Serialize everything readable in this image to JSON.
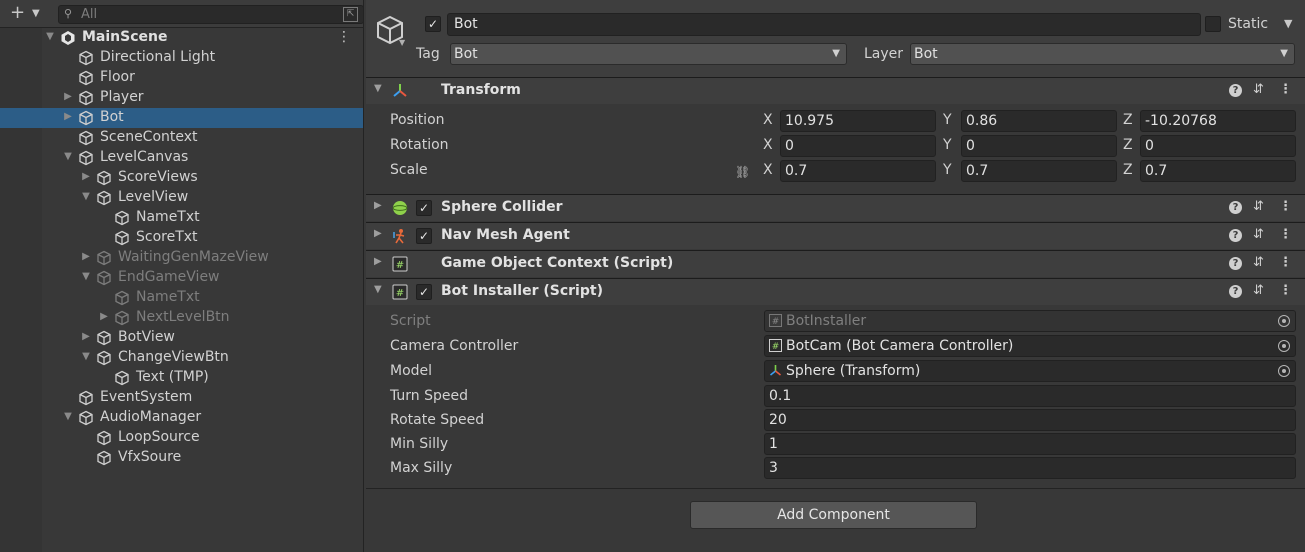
{
  "hierarchy": {
    "search_placeholder": "All",
    "rows": [
      {
        "label": "MainScene",
        "depth": 0,
        "arrow": "down",
        "type": "scene"
      },
      {
        "label": "Directional Light",
        "depth": 1,
        "arrow": ""
      },
      {
        "label": "Floor",
        "depth": 1,
        "arrow": ""
      },
      {
        "label": "Player",
        "depth": 1,
        "arrow": "right"
      },
      {
        "label": "Bot",
        "depth": 1,
        "arrow": "right",
        "selected": true
      },
      {
        "label": "SceneContext",
        "depth": 1,
        "arrow": ""
      },
      {
        "label": "LevelCanvas",
        "depth": 1,
        "arrow": "down"
      },
      {
        "label": "ScoreViews",
        "depth": 2,
        "arrow": "right"
      },
      {
        "label": "LevelView",
        "depth": 2,
        "arrow": "down"
      },
      {
        "label": "NameTxt",
        "depth": 3,
        "arrow": ""
      },
      {
        "label": "ScoreTxt",
        "depth": 3,
        "arrow": ""
      },
      {
        "label": "WaitingGenMazeView",
        "depth": 2,
        "arrow": "right",
        "inactive": true
      },
      {
        "label": "EndGameView",
        "depth": 2,
        "arrow": "down",
        "inactive": true
      },
      {
        "label": "NameTxt",
        "depth": 3,
        "arrow": "",
        "inactive": true
      },
      {
        "label": "NextLevelBtn",
        "depth": 3,
        "arrow": "right",
        "inactive": true
      },
      {
        "label": "BotView",
        "depth": 2,
        "arrow": "right"
      },
      {
        "label": "ChangeViewBtn",
        "depth": 2,
        "arrow": "down"
      },
      {
        "label": "Text (TMP)",
        "depth": 3,
        "arrow": ""
      },
      {
        "label": "EventSystem",
        "depth": 1,
        "arrow": ""
      },
      {
        "label": "AudioManager",
        "depth": 1,
        "arrow": "down"
      },
      {
        "label": "LoopSource",
        "depth": 2,
        "arrow": ""
      },
      {
        "label": "VfxSoure",
        "depth": 2,
        "arrow": ""
      }
    ]
  },
  "inspector": {
    "name": "Bot",
    "static_label": "Static",
    "tag_label": "Tag",
    "tag_value": "Bot",
    "layer_label": "Layer",
    "layer_value": "Bot",
    "transform": {
      "title": "Transform",
      "position_label": "Position",
      "rotation_label": "Rotation",
      "scale_label": "Scale",
      "axes": {
        "x": "X",
        "y": "Y",
        "z": "Z"
      },
      "position": {
        "x": "10.975",
        "y": "0.86",
        "z": "-10.20768"
      },
      "rotation": {
        "x": "0",
        "y": "0",
        "z": "0"
      },
      "scale": {
        "x": "0.7",
        "y": "0.7",
        "z": "0.7"
      }
    },
    "components": {
      "sphere_collider": "Sphere Collider",
      "nav_mesh_agent": "Nav Mesh Agent",
      "game_object_context": "Game Object Context (Script)",
      "bot_installer": "Bot Installer (Script)"
    },
    "bot_installer": {
      "script_label": "Script",
      "script_value": "BotInstaller",
      "camera_controller_label": "Camera Controller",
      "camera_controller_value": "BotCam (Bot Camera Controller)",
      "model_label": "Model",
      "model_value": "Sphere (Transform)",
      "turn_speed_label": "Turn Speed",
      "turn_speed_value": "0.1",
      "rotate_speed_label": "Rotate Speed",
      "rotate_speed_value": "20",
      "min_silly_label": "Min Silly",
      "min_silly_value": "1",
      "max_silly_label": "Max Silly",
      "max_silly_value": "3"
    },
    "add_component_label": "Add Component"
  },
  "colors": {
    "background": "#383838",
    "selection": "#2c5d87",
    "field": "#2a2a2a",
    "header": "#3e3e3e"
  }
}
